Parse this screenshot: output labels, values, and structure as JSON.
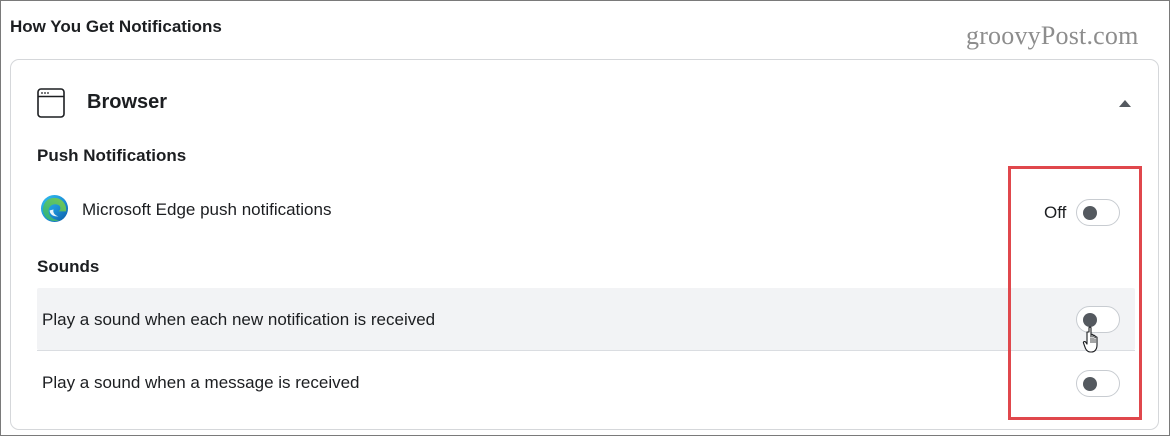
{
  "section": {
    "heading": "How You Get Notifications"
  },
  "watermark": "groovyPost.com",
  "card": {
    "icon": "browser-window-icon",
    "title": "Browser",
    "collapse_icon": "caret-up-icon",
    "push": {
      "heading": "Push Notifications",
      "items": [
        {
          "icon": "microsoft-edge-icon",
          "label": "Microsoft Edge push notifications",
          "state_label": "Off",
          "enabled": false
        }
      ]
    },
    "sounds": {
      "heading": "Sounds",
      "items": [
        {
          "label": "Play a sound when each new notification is received",
          "enabled": false,
          "hovered": true
        },
        {
          "label": "Play a sound when a message is received",
          "enabled": false,
          "hovered": false
        }
      ]
    }
  },
  "colors": {
    "highlight_box": "#e0474c",
    "hover_row_bg": "#f2f3f5",
    "toggle_knob": "#54595f",
    "text": "#1c1e21",
    "watermark": "#8d8d8d"
  },
  "cursor": "hand-pointer-icon"
}
